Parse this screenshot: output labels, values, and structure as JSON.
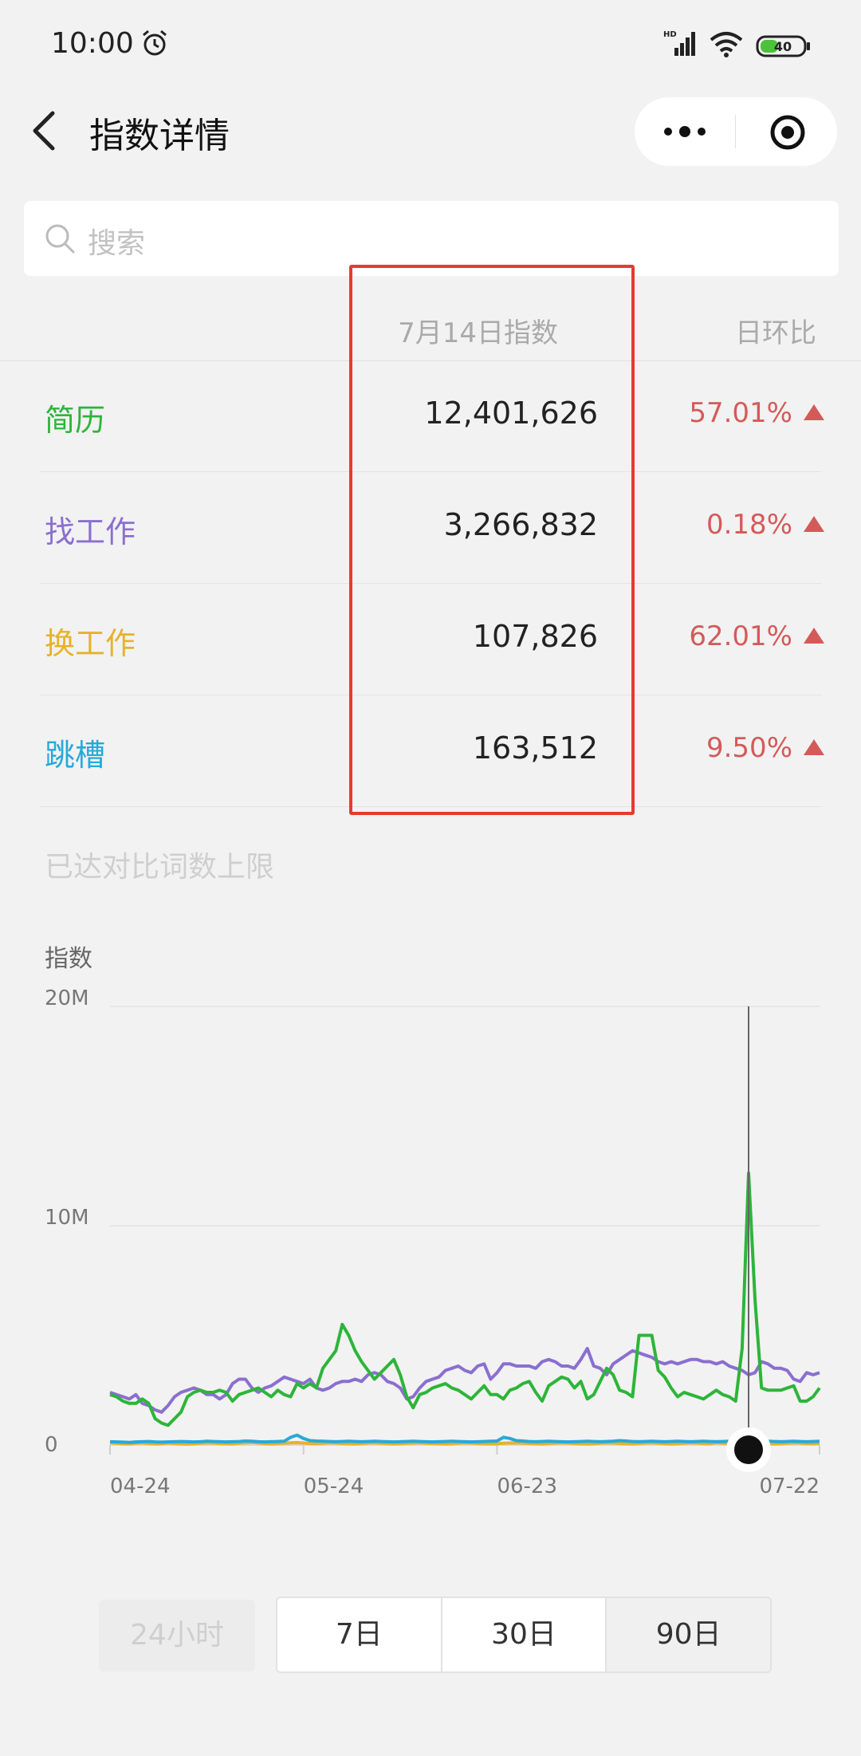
{
  "status": {
    "time": "10:00",
    "battery": "40"
  },
  "nav": {
    "title": "指数详情"
  },
  "search": {
    "placeholder": "搜索"
  },
  "table": {
    "date_header": "7月14日指数",
    "ratio_header": "日环比",
    "rows": [
      {
        "term": "简历",
        "value": "12,401,626",
        "ratio": "57.01%",
        "color": "#2db539"
      },
      {
        "term": "找工作",
        "value": "3,266,832",
        "ratio": "0.18%",
        "color": "#8a6fd0"
      },
      {
        "term": "换工作",
        "value": "107,826",
        "ratio": "62.01%",
        "color": "#e5b32a"
      },
      {
        "term": "跳槽",
        "value": "163,512",
        "ratio": "9.50%",
        "color": "#27a9d9"
      }
    ]
  },
  "limit_note": "已达对比词数上限",
  "chart_data": {
    "type": "line",
    "ylabel": "指数",
    "ylim": [
      0,
      20000000
    ],
    "y_ticks": [
      "0",
      "10M",
      "20M"
    ],
    "x_ticks": [
      "04-24",
      "05-24",
      "06-23",
      "07-22"
    ],
    "x_start": "04-24",
    "x_end": "07-22",
    "selected_date": "07-14",
    "series": [
      {
        "name": "简历",
        "color": "#2db539",
        "values": [
          2.3,
          2.2,
          2.0,
          1.9,
          1.9,
          2.1,
          1.9,
          1.2,
          1.0,
          0.9,
          1.2,
          1.5,
          2.2,
          2.4,
          2.5,
          2.4,
          2.4,
          2.5,
          2.4,
          2.0,
          2.3,
          2.4,
          2.5,
          2.6,
          2.4,
          2.2,
          2.5,
          2.3,
          2.2,
          2.8,
          2.6,
          2.8,
          2.6,
          3.5,
          3.9,
          4.3,
          5.5,
          5.0,
          4.3,
          3.8,
          3.4,
          3.0,
          3.3,
          3.6,
          3.9,
          3.2,
          2.2,
          1.7,
          2.3,
          2.4,
          2.6,
          2.7,
          2.8,
          2.6,
          2.5,
          2.3,
          2.1,
          2.4,
          2.7,
          2.3,
          2.3,
          2.1,
          2.5,
          2.6,
          2.8,
          2.9,
          2.4,
          2.0,
          2.7,
          2.9,
          3.1,
          3.0,
          2.6,
          2.9,
          2.1,
          2.3,
          2.9,
          3.5,
          3.2,
          2.5,
          2.4,
          2.2,
          5.0,
          5.0,
          5.0,
          3.4,
          3.1,
          2.6,
          2.2,
          2.4,
          2.3,
          2.2,
          2.1,
          2.3,
          2.5,
          2.3,
          2.2,
          2.0,
          4.4,
          12.4,
          6.6,
          2.6,
          2.5,
          2.5,
          2.5,
          2.6,
          2.7,
          2.0,
          2.0,
          2.2,
          2.6
        ]
      },
      {
        "name": "找工作",
        "color": "#8a6fd0",
        "values": [
          2.4,
          2.3,
          2.2,
          2.1,
          2.3,
          1.9,
          1.8,
          1.6,
          1.5,
          1.8,
          2.2,
          2.4,
          2.5,
          2.6,
          2.5,
          2.3,
          2.3,
          2.1,
          2.3,
          2.8,
          3.0,
          3.0,
          2.6,
          2.4,
          2.6,
          2.7,
          2.9,
          3.1,
          3.0,
          2.9,
          2.8,
          3.0,
          2.6,
          2.5,
          2.6,
          2.8,
          2.9,
          2.9,
          3.0,
          2.9,
          3.2,
          3.3,
          3.2,
          2.9,
          2.8,
          2.6,
          2.1,
          2.2,
          2.6,
          2.9,
          3.0,
          3.1,
          3.4,
          3.5,
          3.6,
          3.4,
          3.3,
          3.6,
          3.7,
          3.0,
          3.3,
          3.7,
          3.7,
          3.6,
          3.6,
          3.6,
          3.5,
          3.8,
          3.9,
          3.8,
          3.6,
          3.6,
          3.5,
          3.9,
          4.4,
          3.6,
          3.5,
          3.2,
          3.7,
          3.9,
          4.1,
          4.3,
          4.2,
          4.1,
          4.0,
          3.8,
          3.7,
          3.8,
          3.7,
          3.8,
          3.9,
          3.9,
          3.8,
          3.8,
          3.7,
          3.8,
          3.6,
          3.5,
          3.4,
          3.2,
          3.3,
          3.8,
          3.7,
          3.5,
          3.5,
          3.4,
          3.0,
          2.9,
          3.3,
          3.2,
          3.3
        ]
      },
      {
        "name": "换工作",
        "color": "#e5b32a",
        "values": [
          0.1,
          0.08,
          0.06,
          0.05,
          0.08,
          0.1,
          0.07,
          0.05,
          0.06,
          0.09,
          0.07,
          0.05,
          0.04,
          0.06,
          0.08,
          0.1,
          0.09,
          0.07,
          0.06,
          0.05,
          0.08,
          0.1,
          0.12,
          0.09,
          0.06,
          0.05,
          0.07,
          0.08,
          0.1,
          0.11,
          0.09,
          0.07,
          0.06,
          0.08,
          0.1,
          0.09,
          0.07,
          0.06,
          0.05,
          0.07,
          0.09,
          0.1,
          0.08,
          0.06,
          0.05,
          0.06,
          0.08,
          0.09,
          0.1,
          0.08,
          0.07,
          0.06,
          0.05,
          0.06,
          0.08,
          0.1,
          0.09,
          0.07,
          0.06,
          0.05,
          0.06,
          0.08,
          0.09,
          0.1,
          0.08,
          0.07,
          0.06,
          0.05,
          0.07,
          0.09,
          0.1,
          0.09,
          0.07,
          0.06,
          0.05,
          0.06,
          0.08,
          0.1,
          0.09,
          0.07,
          0.06,
          0.05,
          0.07,
          0.09,
          0.1,
          0.08,
          0.06,
          0.05,
          0.06,
          0.08,
          0.1,
          0.09,
          0.07,
          0.06,
          0.11,
          0.08,
          0.06,
          0.05,
          0.07,
          0.11,
          0.1,
          0.08,
          0.06,
          0.05,
          0.06,
          0.08,
          0.1,
          0.09,
          0.07,
          0.06,
          0.08
        ]
      },
      {
        "name": "跳槽",
        "color": "#27a9d9",
        "values": [
          0.15,
          0.14,
          0.13,
          0.12,
          0.14,
          0.15,
          0.16,
          0.14,
          0.13,
          0.14,
          0.15,
          0.16,
          0.15,
          0.14,
          0.15,
          0.17,
          0.16,
          0.15,
          0.14,
          0.15,
          0.16,
          0.18,
          0.17,
          0.15,
          0.14,
          0.15,
          0.16,
          0.17,
          0.35,
          0.45,
          0.3,
          0.2,
          0.18,
          0.17,
          0.16,
          0.15,
          0.16,
          0.17,
          0.16,
          0.15,
          0.16,
          0.17,
          0.16,
          0.15,
          0.14,
          0.15,
          0.16,
          0.17,
          0.16,
          0.15,
          0.14,
          0.15,
          0.16,
          0.17,
          0.16,
          0.15,
          0.14,
          0.15,
          0.16,
          0.17,
          0.18,
          0.35,
          0.3,
          0.2,
          0.18,
          0.16,
          0.15,
          0.16,
          0.17,
          0.16,
          0.15,
          0.14,
          0.15,
          0.16,
          0.17,
          0.16,
          0.15,
          0.16,
          0.17,
          0.2,
          0.18,
          0.16,
          0.15,
          0.16,
          0.17,
          0.16,
          0.15,
          0.16,
          0.17,
          0.16,
          0.15,
          0.16,
          0.17,
          0.16,
          0.15,
          0.16,
          0.17,
          0.16,
          0.15,
          0.16,
          0.17,
          0.18,
          0.17,
          0.16,
          0.15,
          0.16,
          0.17,
          0.16,
          0.15,
          0.16,
          0.17
        ]
      }
    ]
  },
  "range_options": {
    "disabled": "24小时",
    "items": [
      "7日",
      "30日",
      "90日"
    ],
    "active": "90日"
  }
}
